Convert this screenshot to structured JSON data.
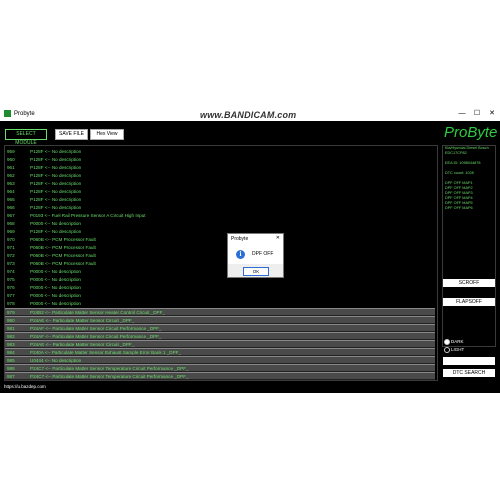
{
  "window": {
    "title": "Probyte",
    "watermark": "www.BANDICAM.com",
    "controls": [
      "—",
      "☐",
      "✕"
    ]
  },
  "toolbar": {
    "select_module": "SELECT MODULE",
    "save_file": "SAVE FILE",
    "hex_view": "Hex View"
  },
  "logo": "ProByte",
  "list": {
    "rows": [
      {
        "num": "959",
        "text": "P128F <-- No description",
        "hl": false
      },
      {
        "num": "960",
        "text": "P128F <-- No description",
        "hl": false
      },
      {
        "num": "961",
        "text": "P128F <-- No description",
        "hl": false
      },
      {
        "num": "962",
        "text": "P128F <-- No description",
        "hl": false
      },
      {
        "num": "963",
        "text": "P128F <-- No description",
        "hl": false
      },
      {
        "num": "964",
        "text": "P128F <-- No description",
        "hl": false
      },
      {
        "num": "965",
        "text": "P128F <-- No description",
        "hl": false
      },
      {
        "num": "966",
        "text": "P128F <-- No description",
        "hl": false
      },
      {
        "num": "967",
        "text": "P0193 <-- Fuel Rail Pressure Sensor A Circuit High Input",
        "hl": false
      },
      {
        "num": "968",
        "text": "P0000 <-- No description",
        "hl": false
      },
      {
        "num": "969",
        "text": "P128F <-- No description",
        "hl": false
      },
      {
        "num": "970",
        "text": "P060B <-- PCM Processor Fault",
        "hl": false
      },
      {
        "num": "971",
        "text": "P060B <-- PCM Processor Fault",
        "hl": false
      },
      {
        "num": "972",
        "text": "P060B <-- PCM Processor Fault",
        "hl": false
      },
      {
        "num": "973",
        "text": "P060B <-- PCM Processor Fault",
        "hl": false
      },
      {
        "num": "974",
        "text": "P0000 <-- No description",
        "hl": false
      },
      {
        "num": "975",
        "text": "P0000 <-- No description",
        "hl": false
      },
      {
        "num": "976",
        "text": "P0000 <-- No description",
        "hl": false
      },
      {
        "num": "977",
        "text": "P0000 <-- No description",
        "hl": false
      },
      {
        "num": "978",
        "text": "P0000 <-- No description",
        "hl": false
      },
      {
        "num": "979",
        "text": "P24B2 <-- Particulate Matter Sensor Heater Control Circuit _DPF_",
        "hl": true
      },
      {
        "num": "980",
        "text": "P24AE <-- Particulate Matter Sensor Circuit _DPF_",
        "hl": true
      },
      {
        "num": "981",
        "text": "P24AF <-- Particulate Matter Sensor Circuit Performance _DPF_",
        "hl": true
      },
      {
        "num": "982",
        "text": "P24AF <-- Particulate Matter Sensor Circuit Performance _DPF_",
        "hl": true
      },
      {
        "num": "983",
        "text": "P24AE <-- Particulate Matter Sensor Circuit _DPF_",
        "hl": true
      },
      {
        "num": "984",
        "text": "P240A <-- Particulate Matter Sensor Exhaust Sample Error Bank 1 _DPF_",
        "hl": true
      },
      {
        "num": "985",
        "text": "U0444 <-- No description",
        "hl": true
      },
      {
        "num": "986",
        "text": "P24C7 <-- Particulate Matter Sensor Temperature Circuit Performance _DPF_",
        "hl": true
      },
      {
        "num": "987",
        "text": "P24C7 <-- Particulate Matter Sensor Temperature Circuit Performance _DPF_",
        "hl": true
      }
    ]
  },
  "info": {
    "lines": [
      "Kia/Hyundai Diesel Bosch",
      "EDC17CP82",
      "",
      "EEA ID: 1098044878",
      "",
      "DTC count: 1028",
      "",
      "DPF OFF MAP1",
      "DPF OFF MAP2",
      "DPF OFF MAP3",
      "DPF OFF MAP4",
      "DPF OFF MAP5",
      "DPF OFF MAP6"
    ]
  },
  "side": {
    "scroff": "SCROFF",
    "flapsoff": "FLAPSOFF",
    "dark": "DARK",
    "light": "LIGHT",
    "dtc_search": "DTC SEARCH"
  },
  "status": "https://u.bazdep.com",
  "dialog": {
    "title": "Probyte",
    "close": "✕",
    "icon": "i",
    "message": "DPF OFF",
    "ok": "OK"
  }
}
